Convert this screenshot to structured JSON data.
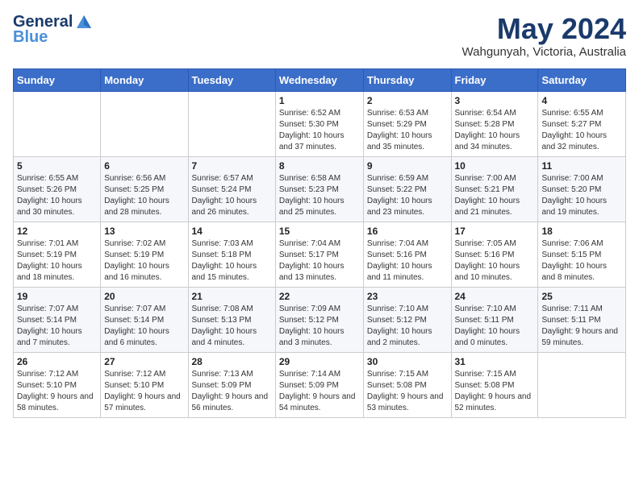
{
  "logo": {
    "general": "General",
    "blue": "Blue"
  },
  "title": "May 2024",
  "location": "Wahgunyah, Victoria, Australia",
  "weekdays": [
    "Sunday",
    "Monday",
    "Tuesday",
    "Wednesday",
    "Thursday",
    "Friday",
    "Saturday"
  ],
  "weeks": [
    [
      {
        "day": "",
        "sunrise": "",
        "sunset": "",
        "daylight": ""
      },
      {
        "day": "",
        "sunrise": "",
        "sunset": "",
        "daylight": ""
      },
      {
        "day": "",
        "sunrise": "",
        "sunset": "",
        "daylight": ""
      },
      {
        "day": "1",
        "sunrise": "Sunrise: 6:52 AM",
        "sunset": "Sunset: 5:30 PM",
        "daylight": "Daylight: 10 hours and 37 minutes."
      },
      {
        "day": "2",
        "sunrise": "Sunrise: 6:53 AM",
        "sunset": "Sunset: 5:29 PM",
        "daylight": "Daylight: 10 hours and 35 minutes."
      },
      {
        "day": "3",
        "sunrise": "Sunrise: 6:54 AM",
        "sunset": "Sunset: 5:28 PM",
        "daylight": "Daylight: 10 hours and 34 minutes."
      },
      {
        "day": "4",
        "sunrise": "Sunrise: 6:55 AM",
        "sunset": "Sunset: 5:27 PM",
        "daylight": "Daylight: 10 hours and 32 minutes."
      }
    ],
    [
      {
        "day": "5",
        "sunrise": "Sunrise: 6:55 AM",
        "sunset": "Sunset: 5:26 PM",
        "daylight": "Daylight: 10 hours and 30 minutes."
      },
      {
        "day": "6",
        "sunrise": "Sunrise: 6:56 AM",
        "sunset": "Sunset: 5:25 PM",
        "daylight": "Daylight: 10 hours and 28 minutes."
      },
      {
        "day": "7",
        "sunrise": "Sunrise: 6:57 AM",
        "sunset": "Sunset: 5:24 PM",
        "daylight": "Daylight: 10 hours and 26 minutes."
      },
      {
        "day": "8",
        "sunrise": "Sunrise: 6:58 AM",
        "sunset": "Sunset: 5:23 PM",
        "daylight": "Daylight: 10 hours and 25 minutes."
      },
      {
        "day": "9",
        "sunrise": "Sunrise: 6:59 AM",
        "sunset": "Sunset: 5:22 PM",
        "daylight": "Daylight: 10 hours and 23 minutes."
      },
      {
        "day": "10",
        "sunrise": "Sunrise: 7:00 AM",
        "sunset": "Sunset: 5:21 PM",
        "daylight": "Daylight: 10 hours and 21 minutes."
      },
      {
        "day": "11",
        "sunrise": "Sunrise: 7:00 AM",
        "sunset": "Sunset: 5:20 PM",
        "daylight": "Daylight: 10 hours and 19 minutes."
      }
    ],
    [
      {
        "day": "12",
        "sunrise": "Sunrise: 7:01 AM",
        "sunset": "Sunset: 5:19 PM",
        "daylight": "Daylight: 10 hours and 18 minutes."
      },
      {
        "day": "13",
        "sunrise": "Sunrise: 7:02 AM",
        "sunset": "Sunset: 5:19 PM",
        "daylight": "Daylight: 10 hours and 16 minutes."
      },
      {
        "day": "14",
        "sunrise": "Sunrise: 7:03 AM",
        "sunset": "Sunset: 5:18 PM",
        "daylight": "Daylight: 10 hours and 15 minutes."
      },
      {
        "day": "15",
        "sunrise": "Sunrise: 7:04 AM",
        "sunset": "Sunset: 5:17 PM",
        "daylight": "Daylight: 10 hours and 13 minutes."
      },
      {
        "day": "16",
        "sunrise": "Sunrise: 7:04 AM",
        "sunset": "Sunset: 5:16 PM",
        "daylight": "Daylight: 10 hours and 11 minutes."
      },
      {
        "day": "17",
        "sunrise": "Sunrise: 7:05 AM",
        "sunset": "Sunset: 5:16 PM",
        "daylight": "Daylight: 10 hours and 10 minutes."
      },
      {
        "day": "18",
        "sunrise": "Sunrise: 7:06 AM",
        "sunset": "Sunset: 5:15 PM",
        "daylight": "Daylight: 10 hours and 8 minutes."
      }
    ],
    [
      {
        "day": "19",
        "sunrise": "Sunrise: 7:07 AM",
        "sunset": "Sunset: 5:14 PM",
        "daylight": "Daylight: 10 hours and 7 minutes."
      },
      {
        "day": "20",
        "sunrise": "Sunrise: 7:07 AM",
        "sunset": "Sunset: 5:14 PM",
        "daylight": "Daylight: 10 hours and 6 minutes."
      },
      {
        "day": "21",
        "sunrise": "Sunrise: 7:08 AM",
        "sunset": "Sunset: 5:13 PM",
        "daylight": "Daylight: 10 hours and 4 minutes."
      },
      {
        "day": "22",
        "sunrise": "Sunrise: 7:09 AM",
        "sunset": "Sunset: 5:12 PM",
        "daylight": "Daylight: 10 hours and 3 minutes."
      },
      {
        "day": "23",
        "sunrise": "Sunrise: 7:10 AM",
        "sunset": "Sunset: 5:12 PM",
        "daylight": "Daylight: 10 hours and 2 minutes."
      },
      {
        "day": "24",
        "sunrise": "Sunrise: 7:10 AM",
        "sunset": "Sunset: 5:11 PM",
        "daylight": "Daylight: 10 hours and 0 minutes."
      },
      {
        "day": "25",
        "sunrise": "Sunrise: 7:11 AM",
        "sunset": "Sunset: 5:11 PM",
        "daylight": "Daylight: 9 hours and 59 minutes."
      }
    ],
    [
      {
        "day": "26",
        "sunrise": "Sunrise: 7:12 AM",
        "sunset": "Sunset: 5:10 PM",
        "daylight": "Daylight: 9 hours and 58 minutes."
      },
      {
        "day": "27",
        "sunrise": "Sunrise: 7:12 AM",
        "sunset": "Sunset: 5:10 PM",
        "daylight": "Daylight: 9 hours and 57 minutes."
      },
      {
        "day": "28",
        "sunrise": "Sunrise: 7:13 AM",
        "sunset": "Sunset: 5:09 PM",
        "daylight": "Daylight: 9 hours and 56 minutes."
      },
      {
        "day": "29",
        "sunrise": "Sunrise: 7:14 AM",
        "sunset": "Sunset: 5:09 PM",
        "daylight": "Daylight: 9 hours and 54 minutes."
      },
      {
        "day": "30",
        "sunrise": "Sunrise: 7:15 AM",
        "sunset": "Sunset: 5:08 PM",
        "daylight": "Daylight: 9 hours and 53 minutes."
      },
      {
        "day": "31",
        "sunrise": "Sunrise: 7:15 AM",
        "sunset": "Sunset: 5:08 PM",
        "daylight": "Daylight: 9 hours and 52 minutes."
      },
      {
        "day": "",
        "sunrise": "",
        "sunset": "",
        "daylight": ""
      }
    ]
  ]
}
